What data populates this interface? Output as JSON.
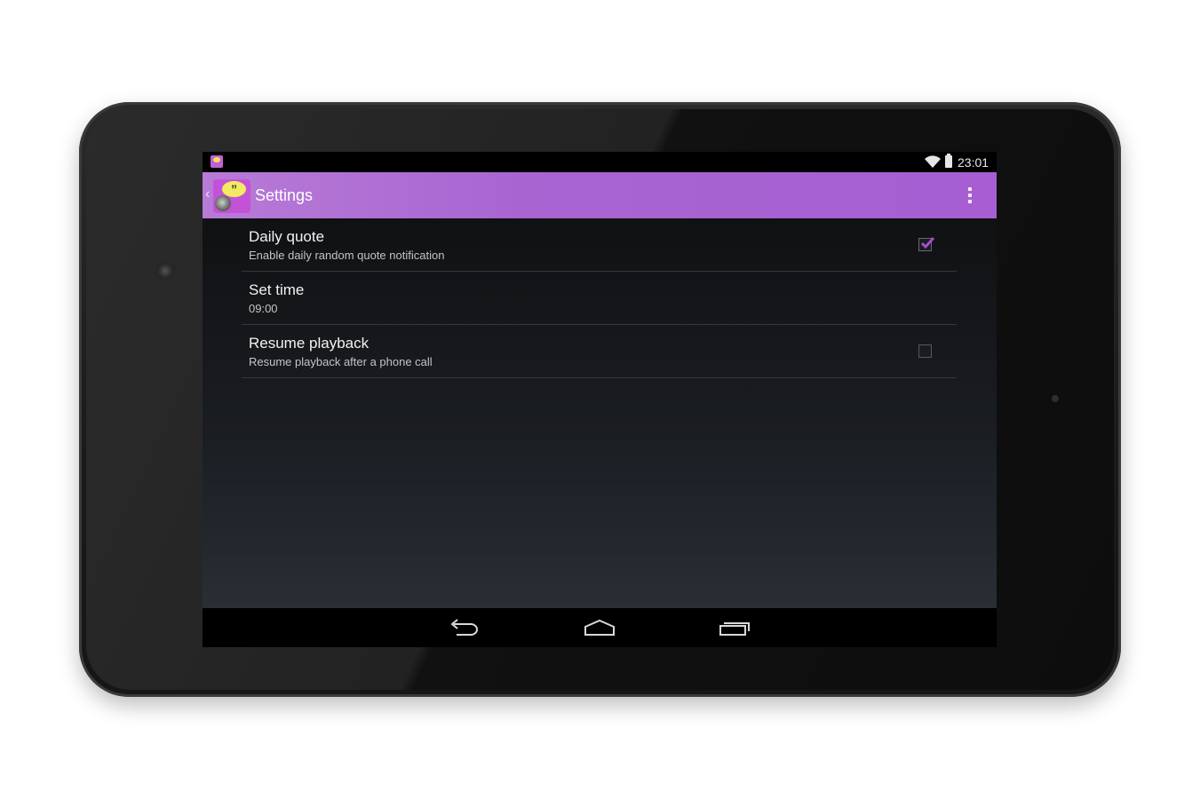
{
  "status_bar": {
    "time": "23:01",
    "icons": [
      "app-notification-icon",
      "wifi-icon",
      "battery-icon"
    ]
  },
  "action_bar": {
    "title": "Settings",
    "icons": [
      "up-caret-icon",
      "app-icon",
      "overflow-menu-icon"
    ],
    "color": "#a865d2"
  },
  "preferences": [
    {
      "title": "Daily quote",
      "summary": "Enable daily random quote notification",
      "widget": "checkbox",
      "checked": true
    },
    {
      "title": "Set time",
      "summary": "09:00",
      "widget": "none"
    },
    {
      "title": "Resume playback",
      "summary": "Resume playback after a phone call",
      "widget": "checkbox",
      "checked": false
    }
  ],
  "accent_color": "#a24fd0",
  "nav_bar": {
    "icons": [
      "back-icon",
      "home-icon",
      "recent-apps-icon"
    ]
  }
}
